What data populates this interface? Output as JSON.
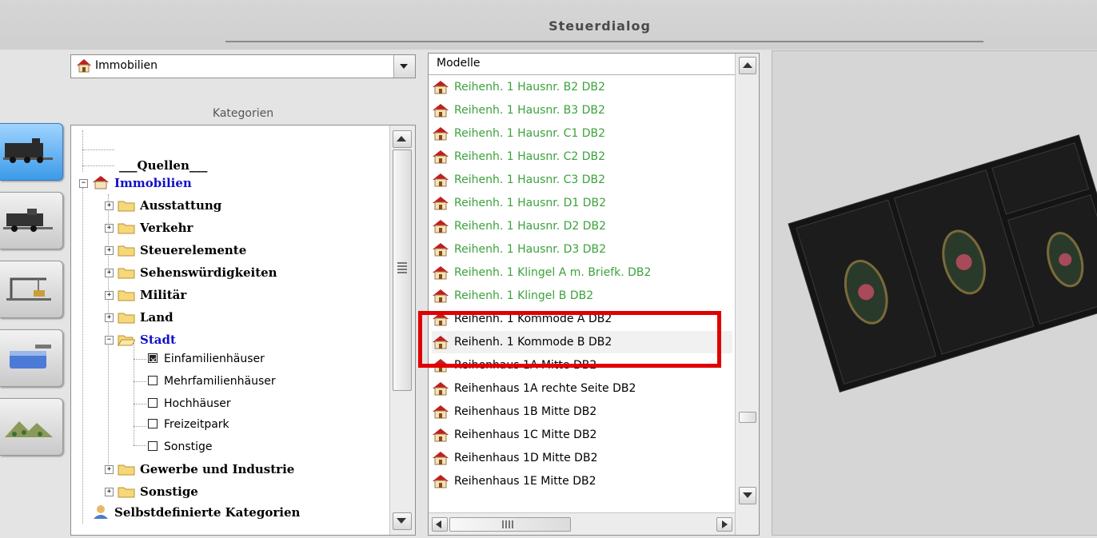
{
  "window": {
    "title": "Steuerdialog"
  },
  "category_dropdown": {
    "value": "Immobilien"
  },
  "categories_label": "Kategorien",
  "tree": {
    "quellen": "___Quellen___",
    "immobilien": "Immobilien",
    "folders": [
      "Ausstattung",
      "Verkehr",
      "Steuerelemente",
      "Sehenswürdigkeiten",
      "Militär",
      "Land"
    ],
    "stadt": "Stadt",
    "stadt_children": [
      "Einfamilienhäuser",
      "Mehrfamilienhäuser",
      "Hochhäuser",
      "Freizeitpark",
      "Sonstige"
    ],
    "folders_after": [
      "Gewerbe und Industrie",
      "Sonstige"
    ],
    "custom": "Selbstdefinierte Kategorien"
  },
  "models": {
    "header": "Modelle",
    "items": [
      "Reihenh. 1 Hausnr. B2 DB2",
      "Reihenh. 1 Hausnr. B3 DB2",
      "Reihenh. 1 Hausnr. C1 DB2",
      "Reihenh. 1 Hausnr. C2 DB2",
      "Reihenh. 1 Hausnr. C3 DB2",
      "Reihenh. 1 Hausnr. D1 DB2",
      "Reihenh. 1 Hausnr. D2 DB2",
      "Reihenh. 1 Hausnr. D3 DB2",
      "Reihenh. 1 Klingel A m. Briefk. DB2",
      "Reihenh. 1 Klingel B DB2",
      "Reihenh. 1 Kommode A DB2",
      "Reihenh. 1 Kommode B DB2",
      "Reihenhaus 1A Mitte DB2",
      "Reihenhaus 1A rechte Seite DB2",
      "Reihenhaus 1B Mitte DB2",
      "Reihenhaus 1C Mitte DB2",
      "Reihenhaus 1D Mitte DB2",
      "Reihenhaus 1E Mitte DB2"
    ],
    "green_count": 10,
    "selected": "Reihenh. 1 Kommode B DB2"
  },
  "colors": {
    "highlight": "#e10000",
    "green_text": "#3ca23c",
    "category_blue": "#1010c8",
    "active_tool": "#3c9ae8"
  }
}
